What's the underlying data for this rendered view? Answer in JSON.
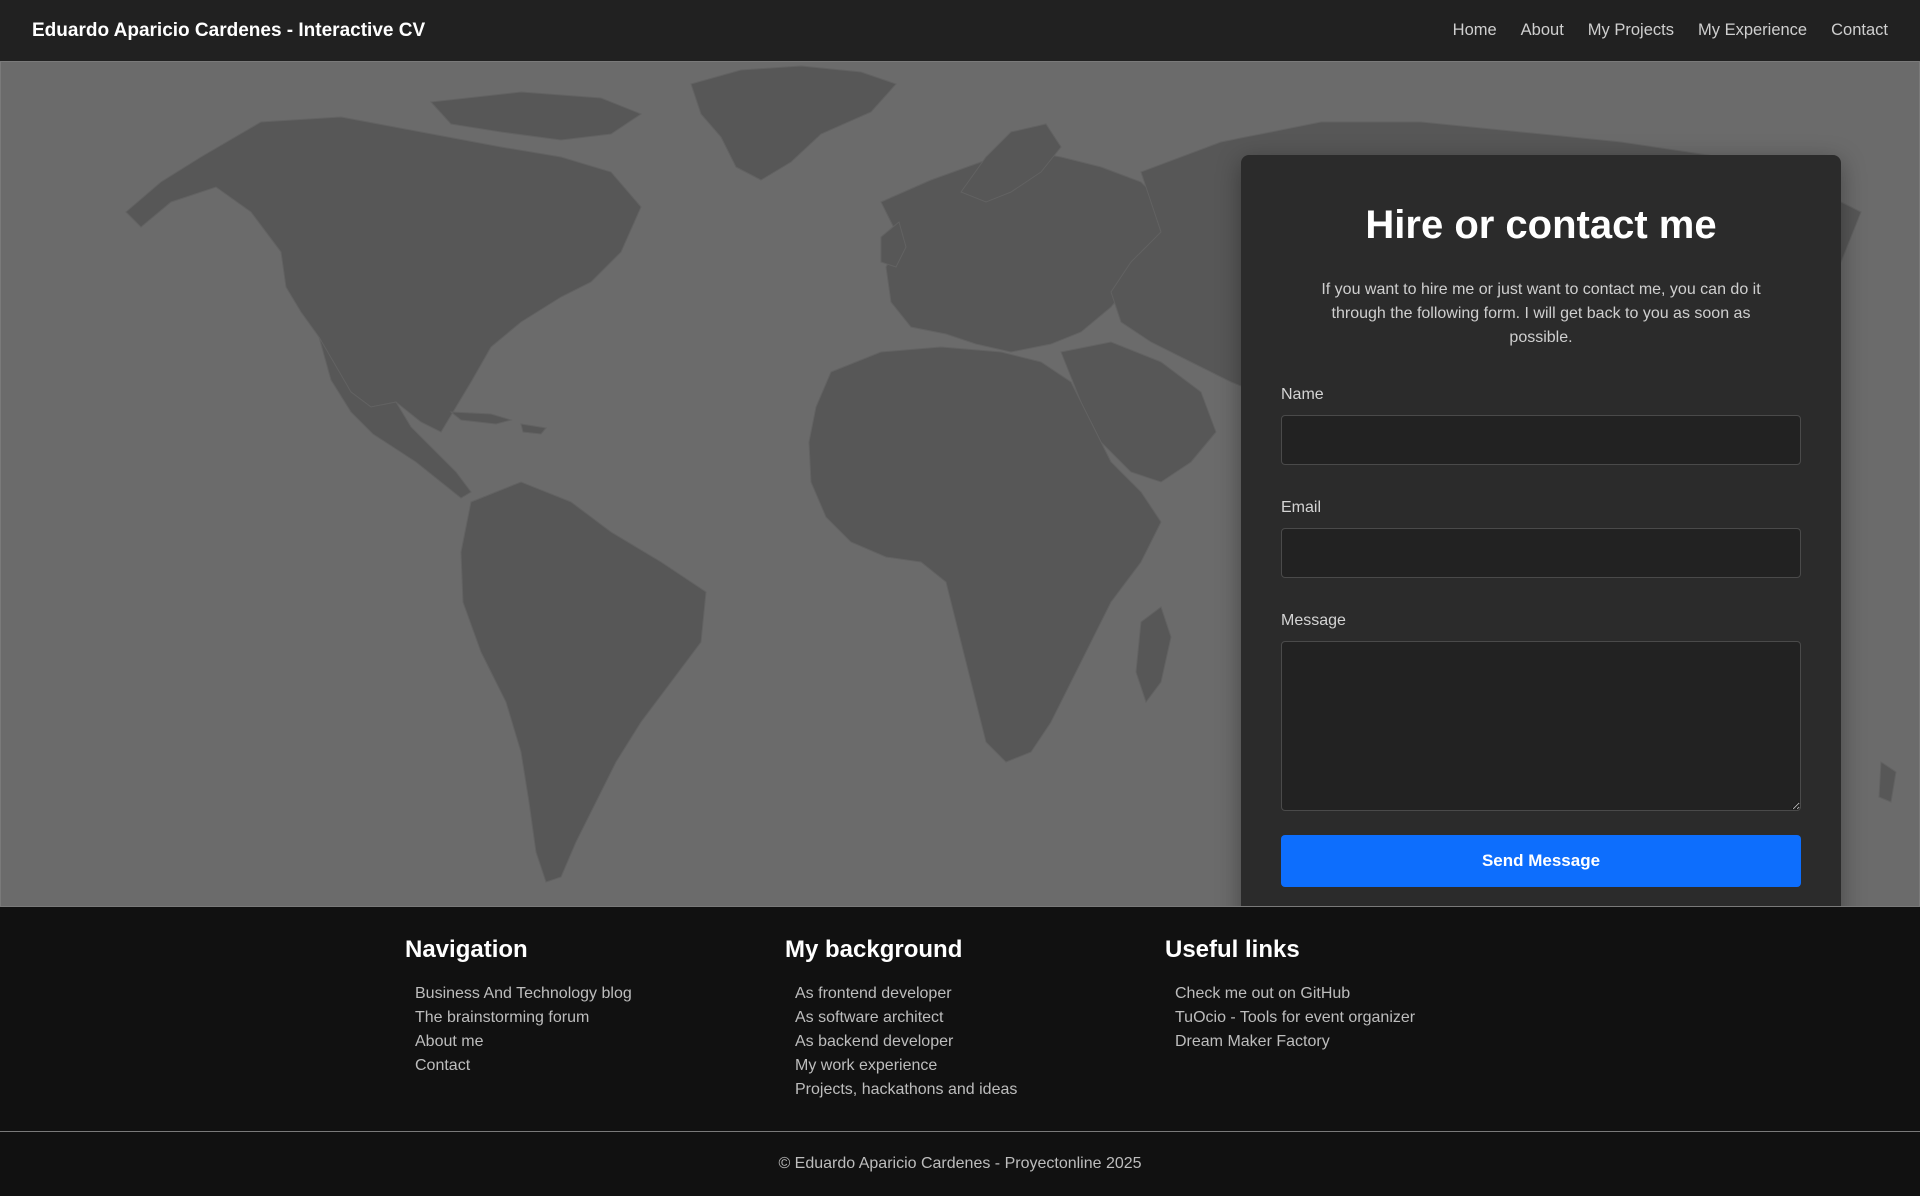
{
  "header": {
    "brand": "Eduardo Aparicio Cardenes - Interactive CV",
    "nav": [
      "Home",
      "About",
      "My Projects",
      "My Experience",
      "Contact"
    ]
  },
  "contact": {
    "title": "Hire or contact me",
    "intro": "If you want to hire me or just want to contact me, you can do it through the following form. I will get back to you as soon as possible.",
    "name_label": "Name",
    "email_label": "Email",
    "message_label": "Message",
    "name_value": "",
    "email_value": "",
    "message_value": "",
    "send_label": "Send Message"
  },
  "footer": {
    "navigation": {
      "title": "Navigation",
      "items": [
        "Business And Technology blog",
        "The brainstorming forum",
        "About me",
        "Contact"
      ]
    },
    "background": {
      "title": "My background",
      "items": [
        "As frontend developer",
        "As software architect",
        "As backend developer",
        "My work experience",
        "Projects, hackathons and ideas"
      ]
    },
    "links": {
      "title": "Useful links",
      "items": [
        "Check me out on GitHub",
        "TuOcio - Tools for event organizer",
        "Dream Maker Factory"
      ]
    },
    "copyright": "© Eduardo Aparicio Cardenes - Proyectonline 2025"
  },
  "colors": {
    "accent": "#0d6efd",
    "header_bg": "#212121",
    "map_bg": "#6b6b6b",
    "land": "#575757",
    "card_bg": "#2b2b2b",
    "footer_bg": "#111111"
  },
  "icons": {
    "background_image": "world-map"
  }
}
